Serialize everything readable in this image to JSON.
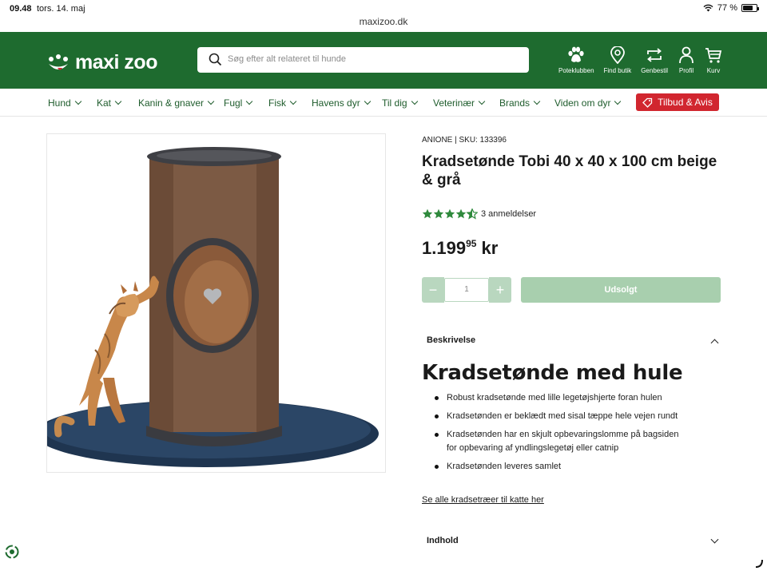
{
  "status": {
    "time": "09.48",
    "date": "tors. 14. maj",
    "battery": "77 %",
    "battery_level": 0.77
  },
  "browser": {
    "url": "maxizoo.dk"
  },
  "header": {
    "logo_text": "maxi zoo",
    "search_placeholder": "Søg efter alt relateret til hunde",
    "icons": [
      {
        "label": "Poteklubben",
        "icon": "paw-icon"
      },
      {
        "label": "Find butik",
        "icon": "location-pin-icon"
      },
      {
        "label": "Genbestil",
        "icon": "reorder-icon"
      },
      {
        "label": "Profil",
        "icon": "profile-icon"
      },
      {
        "label": "Kurv",
        "icon": "cart-icon"
      }
    ]
  },
  "nav": {
    "items": [
      "Hund",
      "Kat",
      "Kanin & gnaver",
      "Fugl",
      "Fisk",
      "Havens dyr",
      "Til dig",
      "Veterinær",
      "Brands",
      "Viden om dyr"
    ],
    "promo": "Tilbud & Avis"
  },
  "product": {
    "meta": "ANIONE | SKU: 133396",
    "title": "Kradsetønde Tobi 40 x 40 x 100 cm beige & grå",
    "rating": 4.5,
    "review_count": "3 anmeldelser",
    "price_main": "1.199",
    "price_cents": "95",
    "price_currency": "kr",
    "quantity": "1",
    "quantity_minus": "−",
    "quantity_plus": "+",
    "button": "Udsolgt"
  },
  "description": {
    "header": "Beskrivelse",
    "title": "Kradsetønde med hule",
    "bullets": [
      "Robust kradsetønde med lille legetøjshjerte foran hulen",
      "Kradsetønden er beklædt med sisal tæppe hele vejen rundt",
      "Kradsetønden har en skjult opbevaringslomme på bagsiden for opbevaring af yndlingslegetøj eller catnip",
      "Kradsetønden leveres samlet"
    ],
    "link": "Se alle kradsetræer til katte her"
  },
  "contents": {
    "header": "Indhold"
  },
  "colors": {
    "brand_green": "#1e6b2f",
    "promo_red": "#d1262f",
    "star_green": "#2f8a3d",
    "disabled_green": "#a8cfae"
  }
}
